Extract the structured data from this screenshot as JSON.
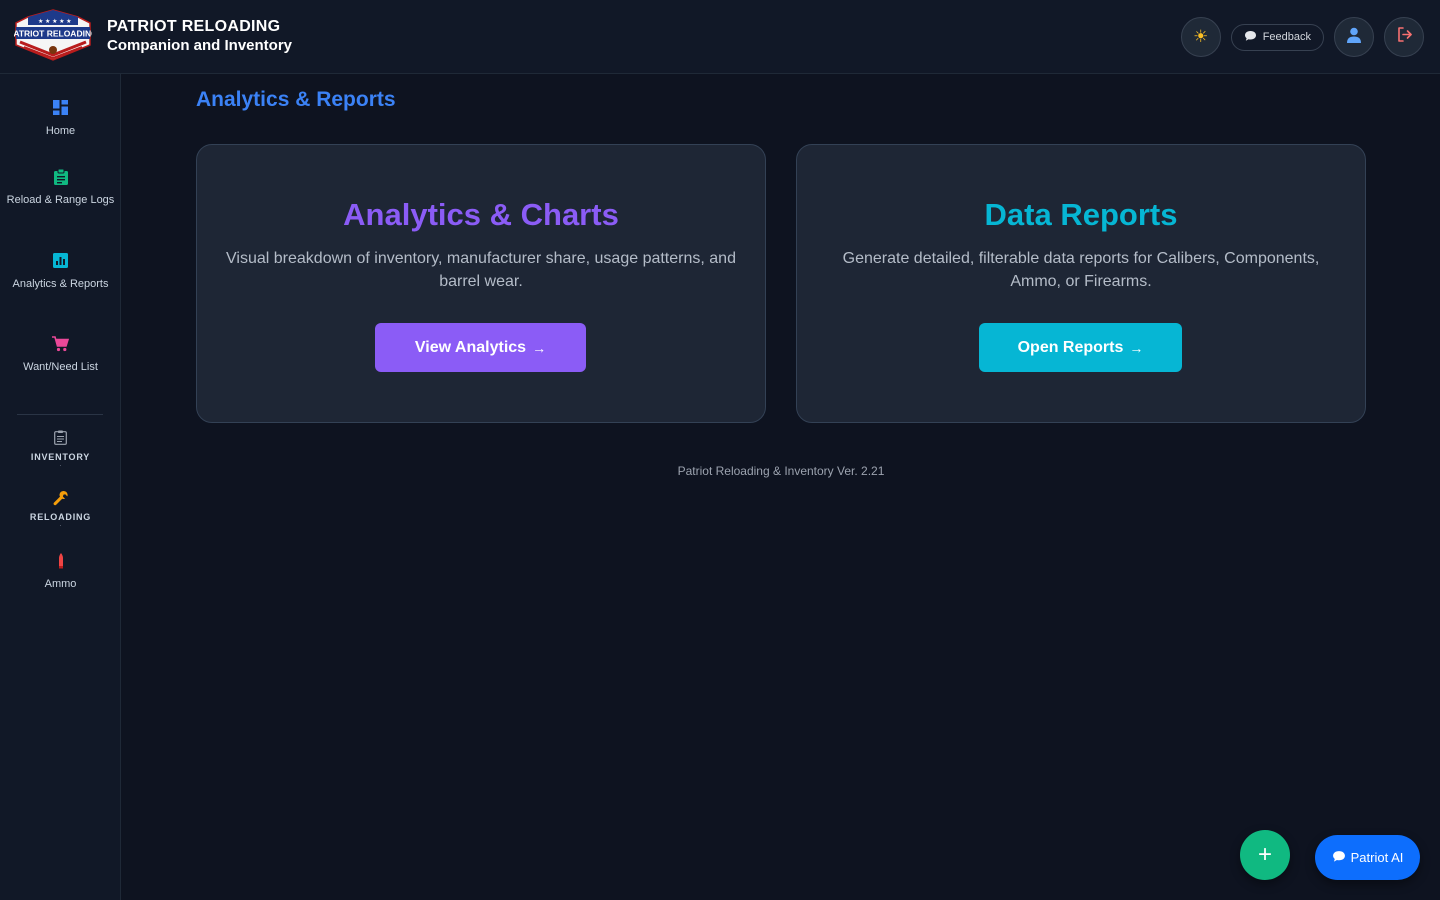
{
  "header": {
    "brand_title": "PATRIOT RELOADING",
    "brand_subtitle": "Companion and Inventory",
    "logo_text": "PATRIOT RELOADING",
    "feedback_label": "Feedback"
  },
  "sidebar": {
    "items": [
      {
        "label": "Home",
        "icon": "dashboard-icon",
        "color": "#3b82f6"
      },
      {
        "label": "Reload & Range Logs",
        "icon": "clipboard-icon",
        "color": "#10b981"
      },
      {
        "label": "Analytics & Reports",
        "icon": "bar-chart-icon",
        "color": "#06b6d4"
      },
      {
        "label": "Want/Need List",
        "icon": "cart-icon",
        "color": "#ec4899"
      }
    ],
    "groups": [
      {
        "label": "INVENTORY",
        "icon": "inventory-icon"
      },
      {
        "label": "RELOADING",
        "icon": "wrench-icon"
      }
    ],
    "ammo_label": "Ammo"
  },
  "main": {
    "page_title": "Analytics & Reports",
    "cards": [
      {
        "title": "Analytics & Charts",
        "description": "Visual breakdown of inventory, manufacturer share, usage patterns, and barrel wear.",
        "button_label": "View Analytics",
        "accent": "#8b5cf6"
      },
      {
        "title": "Data Reports",
        "description": "Generate detailed, filterable data reports for Calibers, Components, Ammo, or Firearms.",
        "button_label": "Open Reports",
        "accent": "#06b6d4"
      }
    ],
    "arrow": "→",
    "version": "Patriot Reloading & Inventory Ver. 2.21"
  },
  "floating": {
    "add_symbol": "+",
    "ai_label": "Patriot AI"
  }
}
